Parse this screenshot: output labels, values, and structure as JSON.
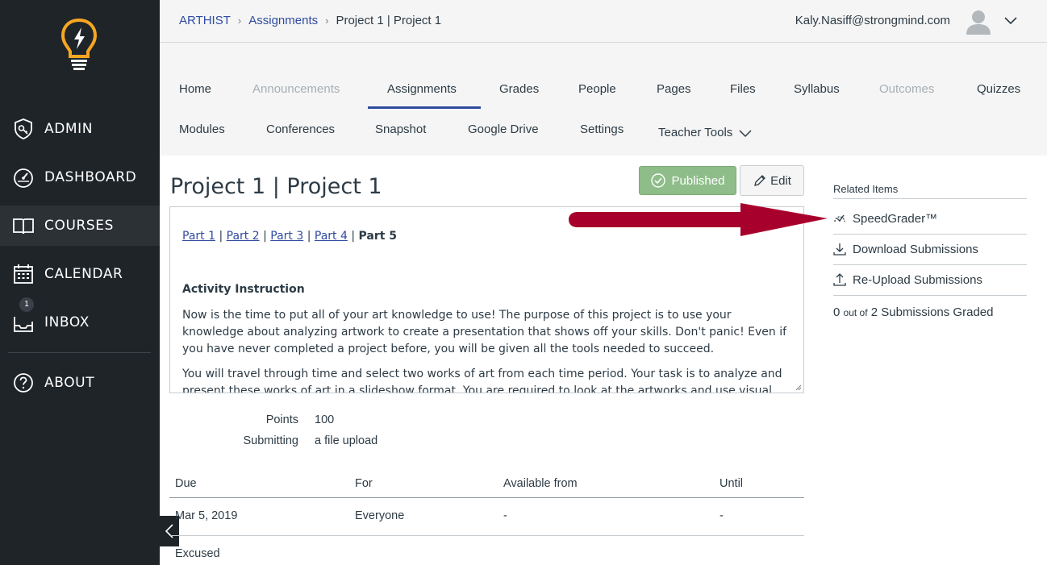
{
  "sidebar": {
    "items": [
      {
        "label": "ADMIN",
        "icon": "shield-key-icon"
      },
      {
        "label": "DASHBOARD",
        "icon": "speedometer-icon"
      },
      {
        "label": "COURSES",
        "icon": "book-icon"
      },
      {
        "label": "CALENDAR",
        "icon": "calendar-icon"
      },
      {
        "label": "INBOX",
        "icon": "inbox-icon",
        "badge": "1"
      },
      {
        "label": "ABOUT",
        "icon": "help-icon"
      }
    ],
    "active": "COURSES"
  },
  "header": {
    "breadcrumb": [
      "ARTHIST",
      "Assignments",
      "Project 1 | Project 1"
    ],
    "user_email": "Kaly.Nasiff@strongmind.com"
  },
  "tabs": {
    "row1": [
      {
        "label": "Home",
        "disabled": false
      },
      {
        "label": "Announcements",
        "disabled": true
      },
      {
        "label": "Assignments",
        "disabled": false,
        "active": true
      },
      {
        "label": "Grades",
        "disabled": false
      },
      {
        "label": "People",
        "disabled": false
      },
      {
        "label": "Pages",
        "disabled": false
      },
      {
        "label": "Files",
        "disabled": false
      },
      {
        "label": "Syllabus",
        "disabled": false
      },
      {
        "label": "Outcomes",
        "disabled": true
      },
      {
        "label": "Quizzes",
        "disabled": false
      }
    ],
    "row2": [
      {
        "label": "Modules"
      },
      {
        "label": "Conferences"
      },
      {
        "label": "Snapshot"
      },
      {
        "label": "Google Drive"
      },
      {
        "label": "Settings"
      },
      {
        "label": "Teacher Tools"
      }
    ]
  },
  "assignment": {
    "title": "Project 1 | Project 1",
    "published_label": "Published",
    "edit_label": "Edit",
    "parts": [
      "Part 1",
      "Part 2",
      "Part 3",
      "Part 4",
      "Part 5"
    ],
    "separator": "|",
    "heading": "Activity Instruction",
    "para1": "Now is the time to put all of your art knowledge to use! The purpose of this project is to use your knowledge about analyzing artwork to create a presentation that shows off your skills. Don't panic! Even if you have never completed a project before, you will be given all the tools needed to succeed.",
    "para2": "You will travel through time and select two works of art from each time period. Your task is to analyze and present these works of art in a slideshow format. You are required to look at the artworks and use visual evidence to",
    "points_label": "Points",
    "points_value": "100",
    "submitting_label": "Submitting",
    "submitting_value": "a file upload"
  },
  "dates_table": {
    "headers": [
      "Due",
      "For",
      "Available from",
      "Until"
    ],
    "rows": [
      [
        "Mar 5, 2019",
        "Everyone",
        "-",
        "-"
      ]
    ],
    "next_row_first_cell": "Excused"
  },
  "related": {
    "title": "Related Items",
    "items": [
      {
        "label": "SpeedGrader™",
        "icon": "speedgrader-icon"
      },
      {
        "label": "Download Submissions",
        "icon": "download-icon"
      },
      {
        "label": "Re-Upload Submissions",
        "icon": "upload-icon"
      }
    ],
    "graded_count": "0",
    "graded_out_of": "out of",
    "graded_total": "2",
    "graded_suffix": "Submissions Graded"
  },
  "colors": {
    "sidebar_bg": "#1f2428",
    "link": "#2f4ba0",
    "published": "#8fbd8a",
    "arrow": "#a8002c",
    "logo": "#f5a623"
  }
}
